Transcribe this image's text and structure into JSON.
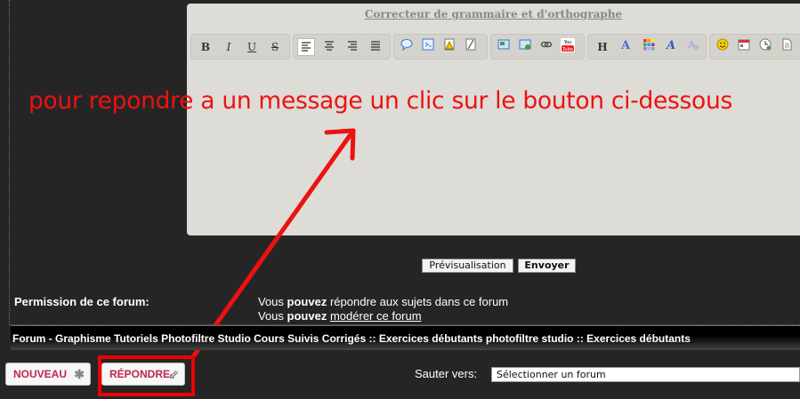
{
  "editor": {
    "title": "Correcteur de grammaire et d'orthographe",
    "toolbar": {
      "bold": "B",
      "italic": "I",
      "underline": "U",
      "strike": "S",
      "heading": "H",
      "font_a": "A",
      "youtube": "You Tube"
    }
  },
  "annotation": {
    "text": "pour repondre a un message un clic sur le bouton ci-dessous",
    "color": "#ee1111"
  },
  "actions": {
    "preview_label": "Prévisualisation",
    "send_label": "Envoyer"
  },
  "permissions": {
    "label": "Permission de ce forum:",
    "line1_prefix": "Vous",
    "line1_bold": "pouvez",
    "line1_suffix": "répondre aux sujets dans ce forum",
    "line2_prefix": "Vous",
    "line2_bold": "pouvez",
    "line2_link": "modérer ce forum"
  },
  "breadcrumb": {
    "text": "Forum - Graphisme Tutoriels Photofiltre Studio Cours Suivis Corrigés :: Exercices débutants photofiltre studio :: Exercices débutants"
  },
  "buttons": {
    "new_label": "NOUVEAU",
    "reply_label": "RÉPONDRE",
    "accent": "#c0264e"
  },
  "jump": {
    "label": "Sauter vers:",
    "selected": "Sélectionner un forum"
  }
}
